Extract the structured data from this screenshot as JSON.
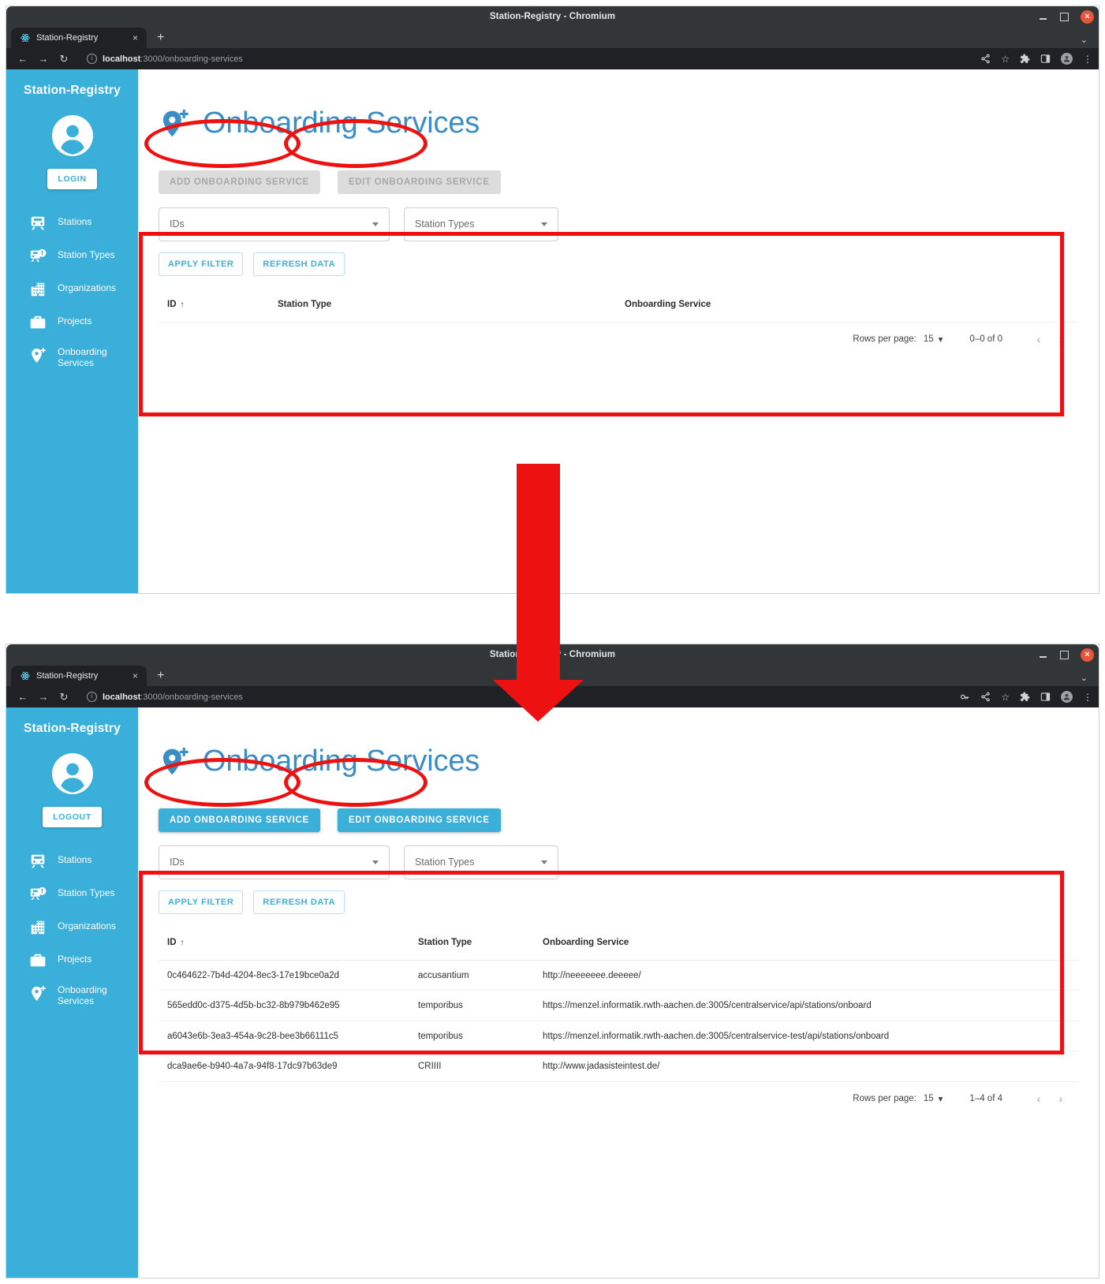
{
  "browser": {
    "window_title": "Station-Registry - Chromium",
    "tab_title": "Station-Registry",
    "tab_close": "×",
    "new_tab": "+",
    "tabstrip_chevron": "⌄",
    "back": "←",
    "forward": "→",
    "reload": "↻",
    "url_host": "localhost",
    "url_path": ":3000/onboarding-services",
    "info_icon_glyph": "i",
    "minimize": "",
    "maximize": "",
    "close": "×",
    "share_icon": "share-icon",
    "star_icon": "☆",
    "extension_icon": "puzzle-icon",
    "sidepanel_icon": "side-panel-icon",
    "profile_icon": "profile-avatar-icon",
    "menu_icon": "⋮",
    "key_icon": "password-key-icon"
  },
  "sidebar": {
    "brand": "Station-Registry",
    "avatar": "account-circle-icon",
    "auth_logged_out": "LOGIN",
    "auth_logged_in": "LOGOUT",
    "items": [
      {
        "label": "Stations",
        "icon": "train-icon"
      },
      {
        "label": "Station Types",
        "icon": "train-alert-icon"
      },
      {
        "label": "Organizations",
        "icon": "office-building-icon"
      },
      {
        "label": "Projects",
        "icon": "briefcase-icon"
      },
      {
        "label": "Onboarding\nServices",
        "icon": "map-marker-plus-icon"
      }
    ]
  },
  "page": {
    "title": "Onboarding Services",
    "title_icon": "map-marker-plus-icon",
    "add_button": "ADD ONBOARDING SERVICE",
    "edit_button": "EDIT ONBOARDING SERVICE",
    "filter_ids_value": "IDs",
    "filter_types_value": "Station Types",
    "apply_filter_button": "APPLY FILTER",
    "refresh_data_button": "REFRESH DATA"
  },
  "table": {
    "headers": {
      "id": "ID",
      "station_type": "Station Type",
      "onboarding_service": "Onboarding Service"
    },
    "sort_arrow": "↑",
    "rows_empty": [],
    "rows_loaded": [
      {
        "id": "0c464622-7b4d-4204-8ec3-17e19bce0a2d",
        "station_type": "accusantium",
        "onboarding_service": "http://neeeeeee.deeeee/"
      },
      {
        "id": "565edd0c-d375-4d5b-bc32-8b979b462e95",
        "station_type": "temporibus",
        "onboarding_service": "https://menzel.informatik.rwth-aachen.de:3005/centralservice/api/stations/onboard"
      },
      {
        "id": "a6043e6b-3ea3-454a-9c28-bee3b66111c5",
        "station_type": "temporibus",
        "onboarding_service": "https://menzel.informatik.rwth-aachen.de:3005/centralservice-test/api/stations/onboard"
      },
      {
        "id": "dca9ae6e-b940-4a7a-94f8-17dc97b63de9",
        "station_type": "CRIIII",
        "onboarding_service": "http://www.jadasisteintest.de/"
      }
    ]
  },
  "pagination": {
    "rows_per_page_label": "Rows per page:",
    "rows_per_page_value": "15",
    "caret": "▾",
    "range_empty": "0–0 of 0",
    "range_loaded": "1–4 of 4",
    "prev": "‹",
    "next": "›"
  },
  "colors": {
    "sidebar": "#3aafd9",
    "title_blue": "#3c8dc5",
    "annotation_red": "#ee1111",
    "chrome_dark": "#323639",
    "omnibox_dark": "#202124"
  },
  "annotations": {
    "highlight_add_button": "ellipse",
    "highlight_edit_button": "ellipse",
    "highlight_table": "rectangle",
    "flow_arrow": "down-arrow"
  }
}
